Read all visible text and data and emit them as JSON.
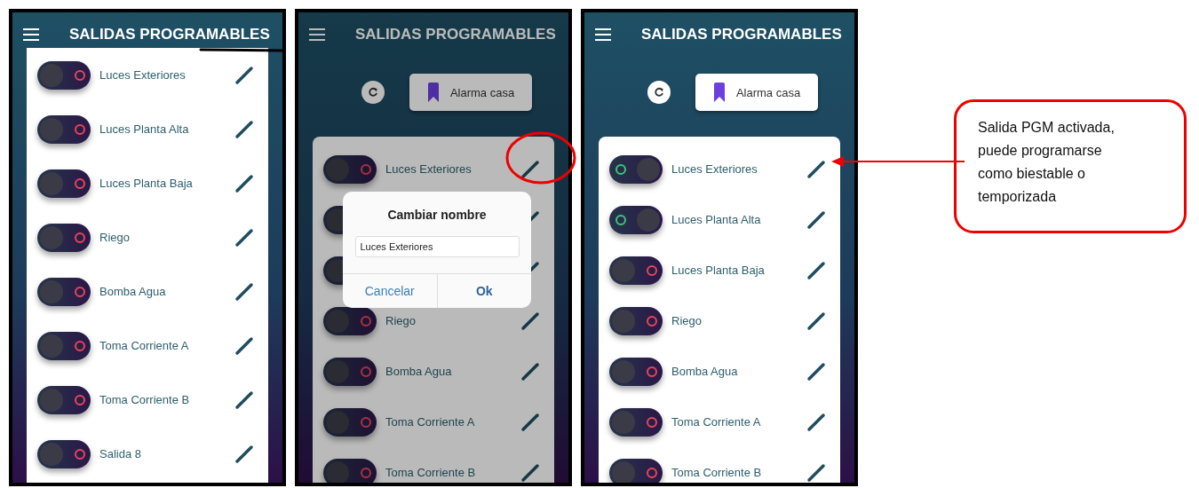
{
  "screens": [
    {
      "title": "SALIDAS PROGRAMABLES",
      "markup": {
        "kind": "underline"
      },
      "items": [
        {
          "label": "Luces Exteriores",
          "on": false
        },
        {
          "label": "Luces Planta Alta",
          "on": false
        },
        {
          "label": "Luces Planta Baja",
          "on": false
        },
        {
          "label": "Riego",
          "on": false
        },
        {
          "label": "Bomba Agua",
          "on": false
        },
        {
          "label": "Toma Corriente A",
          "on": false
        },
        {
          "label": "Toma Corriente B",
          "on": false
        },
        {
          "label": "Salida 8",
          "on": false
        }
      ]
    },
    {
      "title": "SALIDAS PROGRAMABLES",
      "markup": {
        "kind": "ellipse"
      },
      "toolbar": {
        "alarm_button": "Alarma casa"
      },
      "items": [
        {
          "label": "Luces Exteriores",
          "on": false
        },
        {
          "on": false
        },
        {
          "on": false
        },
        {
          "label": "Riego",
          "on": false
        },
        {
          "label": "Bomba Agua",
          "on": false
        },
        {
          "label": "Toma Corriente A",
          "on": false
        },
        {
          "label": "Toma Corriente B",
          "on": false
        }
      ],
      "dialog": {
        "title": "Cambiar nombre",
        "value": "Luces Exteriores",
        "buttons": [
          "Cancelar",
          "Ok"
        ]
      }
    },
    {
      "title": "SALIDAS PROGRAMABLES",
      "toolbar": {
        "alarm_button": "Alarma casa"
      },
      "items": [
        {
          "label": "Luces Exteriores",
          "on": true
        },
        {
          "label": "Luces Planta Alta",
          "on": true
        },
        {
          "label": "Luces Planta Baja",
          "on": false
        },
        {
          "label": "Riego",
          "on": false
        },
        {
          "label": "Bomba Agua",
          "on": false
        },
        {
          "label": "Toma Corriente A",
          "on": false
        },
        {
          "label": "Toma Corriente B",
          "on": false
        }
      ]
    }
  ],
  "callout": {
    "text": "Salida PGM activada, puede programarse como biestable o temporizada"
  }
}
